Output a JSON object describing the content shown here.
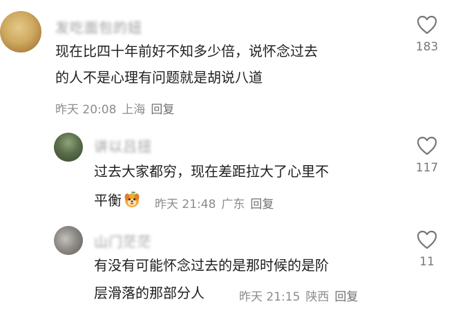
{
  "comments": [
    {
      "username": "发吃面包的妞",
      "lines": [
        "现在比四十年前好不知多少倍，说怀念过去",
        "的人不是心理有问题就是胡说八道"
      ],
      "time": "昨天 20:08",
      "location": "上海",
      "reply": "回复",
      "likes": "183"
    },
    {
      "username": "讲以吕扭",
      "lines": [
        "过去大家都穷，现在差距拉大了心里不",
        "平衡"
      ],
      "emoji": "dog-face-emoji",
      "time": "昨天 21:48",
      "location": "广东",
      "reply": "回复",
      "likes": "117"
    },
    {
      "username": "山门茫茫",
      "lines": [
        "有没有可能怀念过去的是那时候的是阶",
        "层滑落的那部分人"
      ],
      "time": "昨天 21:15",
      "location": "陕西",
      "reply": "回复",
      "likes": "11"
    }
  ],
  "icons": {
    "like": "heart-outline-icon"
  }
}
